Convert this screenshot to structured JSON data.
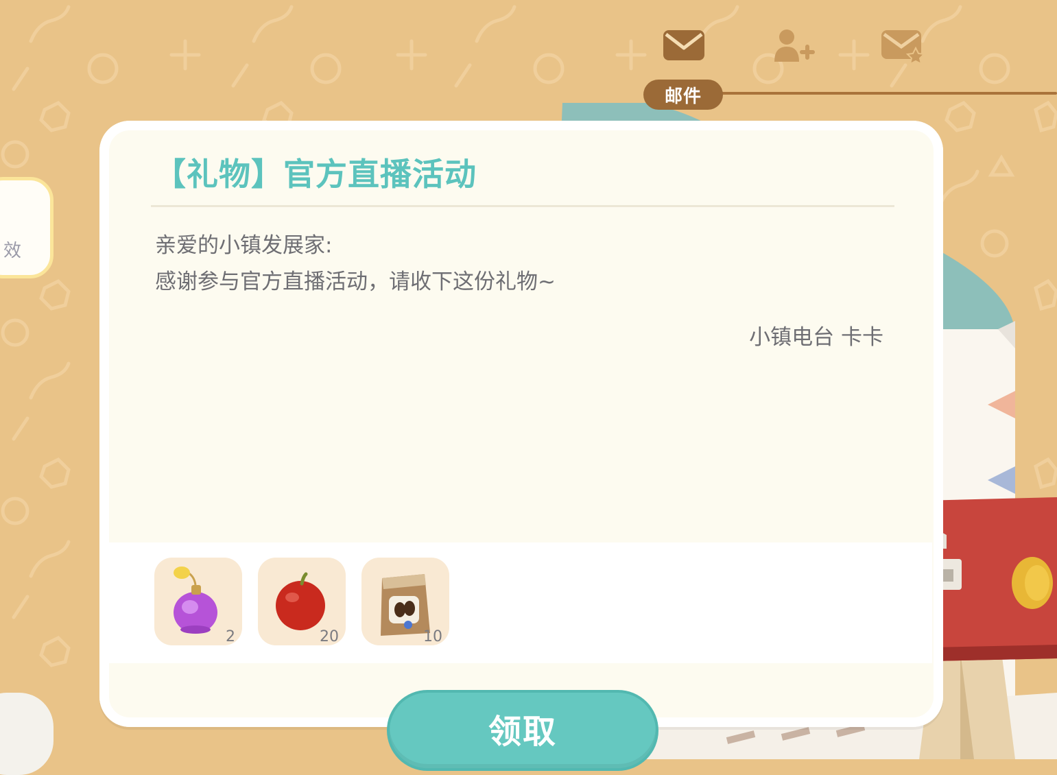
{
  "nav": {
    "tabs": [
      {
        "icon": "mail-icon",
        "label": "邮件",
        "active": true
      },
      {
        "icon": "add-friend-icon",
        "active": false
      },
      {
        "icon": "starred-mail-icon",
        "active": false
      }
    ]
  },
  "left_panel": {
    "partial_text": "效"
  },
  "mail": {
    "title": "【礼物】官方直播活动",
    "greeting": "亲爱的小镇发展家:",
    "body": "感谢参与官方直播活动，请收下这份礼物~",
    "signature": "小镇电台 卡卡",
    "attachments": [
      {
        "icon": "perfume-bottle-icon",
        "quantity": "2"
      },
      {
        "icon": "apple-icon",
        "quantity": "20"
      },
      {
        "icon": "coffee-bean-bag-icon",
        "quantity": "10"
      }
    ],
    "claim_label": "领取"
  },
  "colors": {
    "background": "#e9c388",
    "accent": "#65c8c0",
    "title": "#5cc3bd",
    "tab_active": "#9b6a37"
  }
}
